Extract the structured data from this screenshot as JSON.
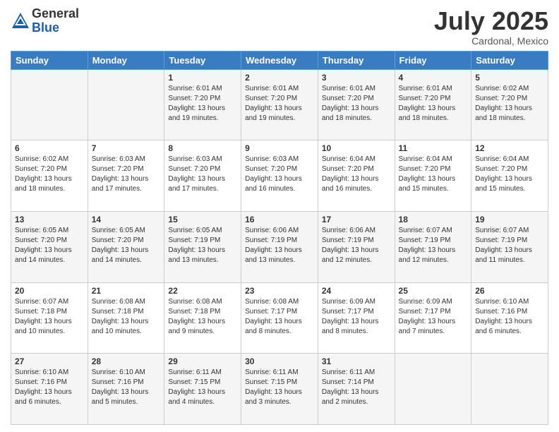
{
  "logo": {
    "general": "General",
    "blue": "Blue"
  },
  "title": "July 2025",
  "subtitle": "Cardonal, Mexico",
  "days_of_week": [
    "Sunday",
    "Monday",
    "Tuesday",
    "Wednesday",
    "Thursday",
    "Friday",
    "Saturday"
  ],
  "weeks": [
    [
      {
        "day": "",
        "info": ""
      },
      {
        "day": "",
        "info": ""
      },
      {
        "day": "1",
        "info": "Sunrise: 6:01 AM\nSunset: 7:20 PM\nDaylight: 13 hours and 19 minutes."
      },
      {
        "day": "2",
        "info": "Sunrise: 6:01 AM\nSunset: 7:20 PM\nDaylight: 13 hours and 19 minutes."
      },
      {
        "day": "3",
        "info": "Sunrise: 6:01 AM\nSunset: 7:20 PM\nDaylight: 13 hours and 18 minutes."
      },
      {
        "day": "4",
        "info": "Sunrise: 6:01 AM\nSunset: 7:20 PM\nDaylight: 13 hours and 18 minutes."
      },
      {
        "day": "5",
        "info": "Sunrise: 6:02 AM\nSunset: 7:20 PM\nDaylight: 13 hours and 18 minutes."
      }
    ],
    [
      {
        "day": "6",
        "info": "Sunrise: 6:02 AM\nSunset: 7:20 PM\nDaylight: 13 hours and 18 minutes."
      },
      {
        "day": "7",
        "info": "Sunrise: 6:03 AM\nSunset: 7:20 PM\nDaylight: 13 hours and 17 minutes."
      },
      {
        "day": "8",
        "info": "Sunrise: 6:03 AM\nSunset: 7:20 PM\nDaylight: 13 hours and 17 minutes."
      },
      {
        "day": "9",
        "info": "Sunrise: 6:03 AM\nSunset: 7:20 PM\nDaylight: 13 hours and 16 minutes."
      },
      {
        "day": "10",
        "info": "Sunrise: 6:04 AM\nSunset: 7:20 PM\nDaylight: 13 hours and 16 minutes."
      },
      {
        "day": "11",
        "info": "Sunrise: 6:04 AM\nSunset: 7:20 PM\nDaylight: 13 hours and 15 minutes."
      },
      {
        "day": "12",
        "info": "Sunrise: 6:04 AM\nSunset: 7:20 PM\nDaylight: 13 hours and 15 minutes."
      }
    ],
    [
      {
        "day": "13",
        "info": "Sunrise: 6:05 AM\nSunset: 7:20 PM\nDaylight: 13 hours and 14 minutes."
      },
      {
        "day": "14",
        "info": "Sunrise: 6:05 AM\nSunset: 7:20 PM\nDaylight: 13 hours and 14 minutes."
      },
      {
        "day": "15",
        "info": "Sunrise: 6:05 AM\nSunset: 7:19 PM\nDaylight: 13 hours and 13 minutes."
      },
      {
        "day": "16",
        "info": "Sunrise: 6:06 AM\nSunset: 7:19 PM\nDaylight: 13 hours and 13 minutes."
      },
      {
        "day": "17",
        "info": "Sunrise: 6:06 AM\nSunset: 7:19 PM\nDaylight: 13 hours and 12 minutes."
      },
      {
        "day": "18",
        "info": "Sunrise: 6:07 AM\nSunset: 7:19 PM\nDaylight: 13 hours and 12 minutes."
      },
      {
        "day": "19",
        "info": "Sunrise: 6:07 AM\nSunset: 7:19 PM\nDaylight: 13 hours and 11 minutes."
      }
    ],
    [
      {
        "day": "20",
        "info": "Sunrise: 6:07 AM\nSunset: 7:18 PM\nDaylight: 13 hours and 10 minutes."
      },
      {
        "day": "21",
        "info": "Sunrise: 6:08 AM\nSunset: 7:18 PM\nDaylight: 13 hours and 10 minutes."
      },
      {
        "day": "22",
        "info": "Sunrise: 6:08 AM\nSunset: 7:18 PM\nDaylight: 13 hours and 9 minutes."
      },
      {
        "day": "23",
        "info": "Sunrise: 6:08 AM\nSunset: 7:17 PM\nDaylight: 13 hours and 8 minutes."
      },
      {
        "day": "24",
        "info": "Sunrise: 6:09 AM\nSunset: 7:17 PM\nDaylight: 13 hours and 8 minutes."
      },
      {
        "day": "25",
        "info": "Sunrise: 6:09 AM\nSunset: 7:17 PM\nDaylight: 13 hours and 7 minutes."
      },
      {
        "day": "26",
        "info": "Sunrise: 6:10 AM\nSunset: 7:16 PM\nDaylight: 13 hours and 6 minutes."
      }
    ],
    [
      {
        "day": "27",
        "info": "Sunrise: 6:10 AM\nSunset: 7:16 PM\nDaylight: 13 hours and 6 minutes."
      },
      {
        "day": "28",
        "info": "Sunrise: 6:10 AM\nSunset: 7:16 PM\nDaylight: 13 hours and 5 minutes."
      },
      {
        "day": "29",
        "info": "Sunrise: 6:11 AM\nSunset: 7:15 PM\nDaylight: 13 hours and 4 minutes."
      },
      {
        "day": "30",
        "info": "Sunrise: 6:11 AM\nSunset: 7:15 PM\nDaylight: 13 hours and 3 minutes."
      },
      {
        "day": "31",
        "info": "Sunrise: 6:11 AM\nSunset: 7:14 PM\nDaylight: 13 hours and 2 minutes."
      },
      {
        "day": "",
        "info": ""
      },
      {
        "day": "",
        "info": ""
      }
    ]
  ]
}
